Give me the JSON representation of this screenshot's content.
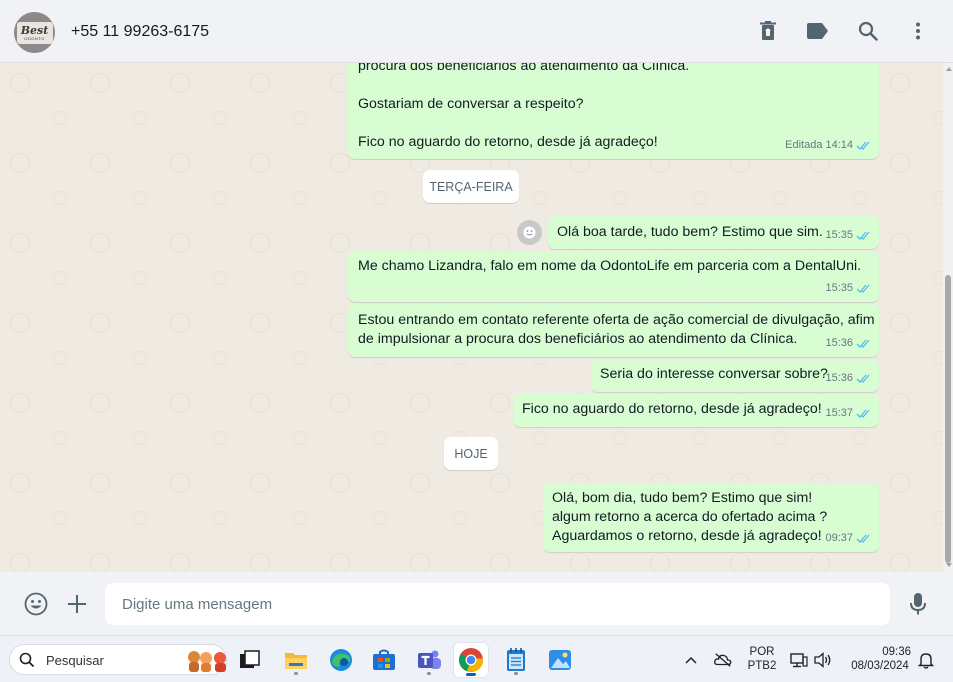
{
  "contact": {
    "name": "+55 11 99263-6175",
    "avatar_logo": "Best",
    "avatar_sub": "ODONTO"
  },
  "header_icons": [
    "trash-icon",
    "label-icon",
    "search-icon",
    "menu-icon"
  ],
  "messages": [
    {
      "text": "procura dos beneficiários ao atendimento da Clínica.\n\nGostariam de conversar a respeito?\n\nFico no aguardo do retorno, desde já agradeço!",
      "edited": "Editada",
      "time": "14:14"
    },
    {
      "text": "Olá boa tarde, tudo bem? Estimo que sim.",
      "time": "15:35"
    },
    {
      "text": "Me chamo Lizandra, falo em nome da OdontoLife em parceria com a DentalUni.",
      "time": "15:35"
    },
    {
      "text": "Estou entrando em contato referente oferta de ação comercial de divulgação, afim\nde impulsionar a procura dos beneficiários ao atendimento da Clínica.",
      "time": "15:36"
    },
    {
      "text": "Seria do interesse conversar sobre?",
      "time": "15:36"
    },
    {
      "text": "Fico no aguardo do retorno, desde já agradeço!",
      "time": "15:37"
    },
    {
      "text": "Olá, bom dia, tudo bem? Estimo que sim!\nalgum retorno a acerca do ofertado acima ?\nAguardamos o retorno, desde já agradeço!",
      "time": "09:37"
    }
  ],
  "day_separators": [
    "TERÇA-FEIRA",
    "HOJE"
  ],
  "composer": {
    "placeholder": "Digite uma mensagem"
  },
  "taskbar": {
    "search_placeholder": "Pesquisar",
    "apps": [
      "task-view-icon",
      "file-explorer-icon",
      "edge-icon",
      "store-icon",
      "teams-icon",
      "chrome-icon",
      "notepad-icon",
      "photos-icon"
    ],
    "language": "POR",
    "keyboard": "PTB2",
    "clock_time": "09:36",
    "clock_date": "08/03/2024"
  },
  "colors": {
    "outgoing_bubble": "#d9fdd3",
    "chat_background": "#efeae2",
    "header_background": "#f0f2f5",
    "read_ticks": "#53bdeb",
    "meta_text": "#667781"
  }
}
